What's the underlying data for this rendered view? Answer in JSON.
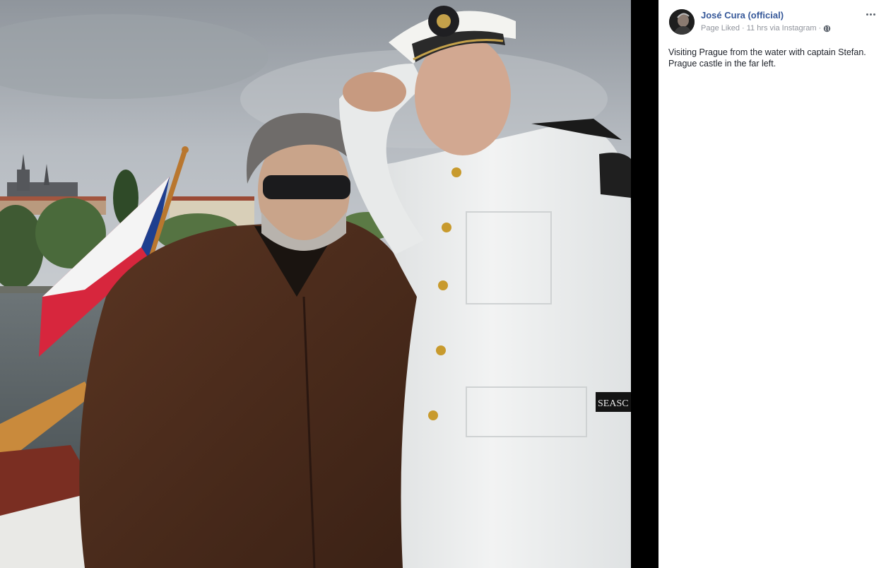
{
  "post": {
    "page_name": "José Cura (official)",
    "status": "Page Liked",
    "time": "11 hrs via Instagram",
    "caption": "Visiting Prague from the water with captain Stefan.\nPrague castle in the far left."
  },
  "photo": {
    "sleeve_text": "SEASC",
    "sky_color": "#a9afb6",
    "jacket_color": "#4a2b1a",
    "uniform_color": "#eceeee",
    "accent": "#365899"
  },
  "icons": {
    "more": "more-options-icon",
    "privacy": "globe-icon"
  }
}
